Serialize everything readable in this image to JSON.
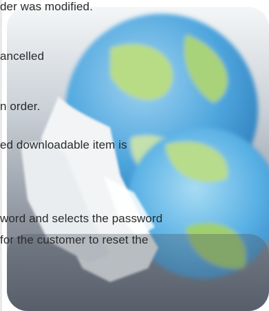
{
  "help_text": {
    "lines": [
      "der was modified.",
      "ancelled",
      "n order.",
      "ed downloadable item is",
      "word and selects the password",
      "for the customer to reset the"
    ]
  },
  "icon": {
    "name": "globe-users-icon",
    "colors": {
      "tile_top": "#eef1f3",
      "tile_bottom": "#616875",
      "globe_blue": "#4fa6de",
      "globe_green": "#a9d37a",
      "person_white": "#f2f4f5"
    }
  }
}
